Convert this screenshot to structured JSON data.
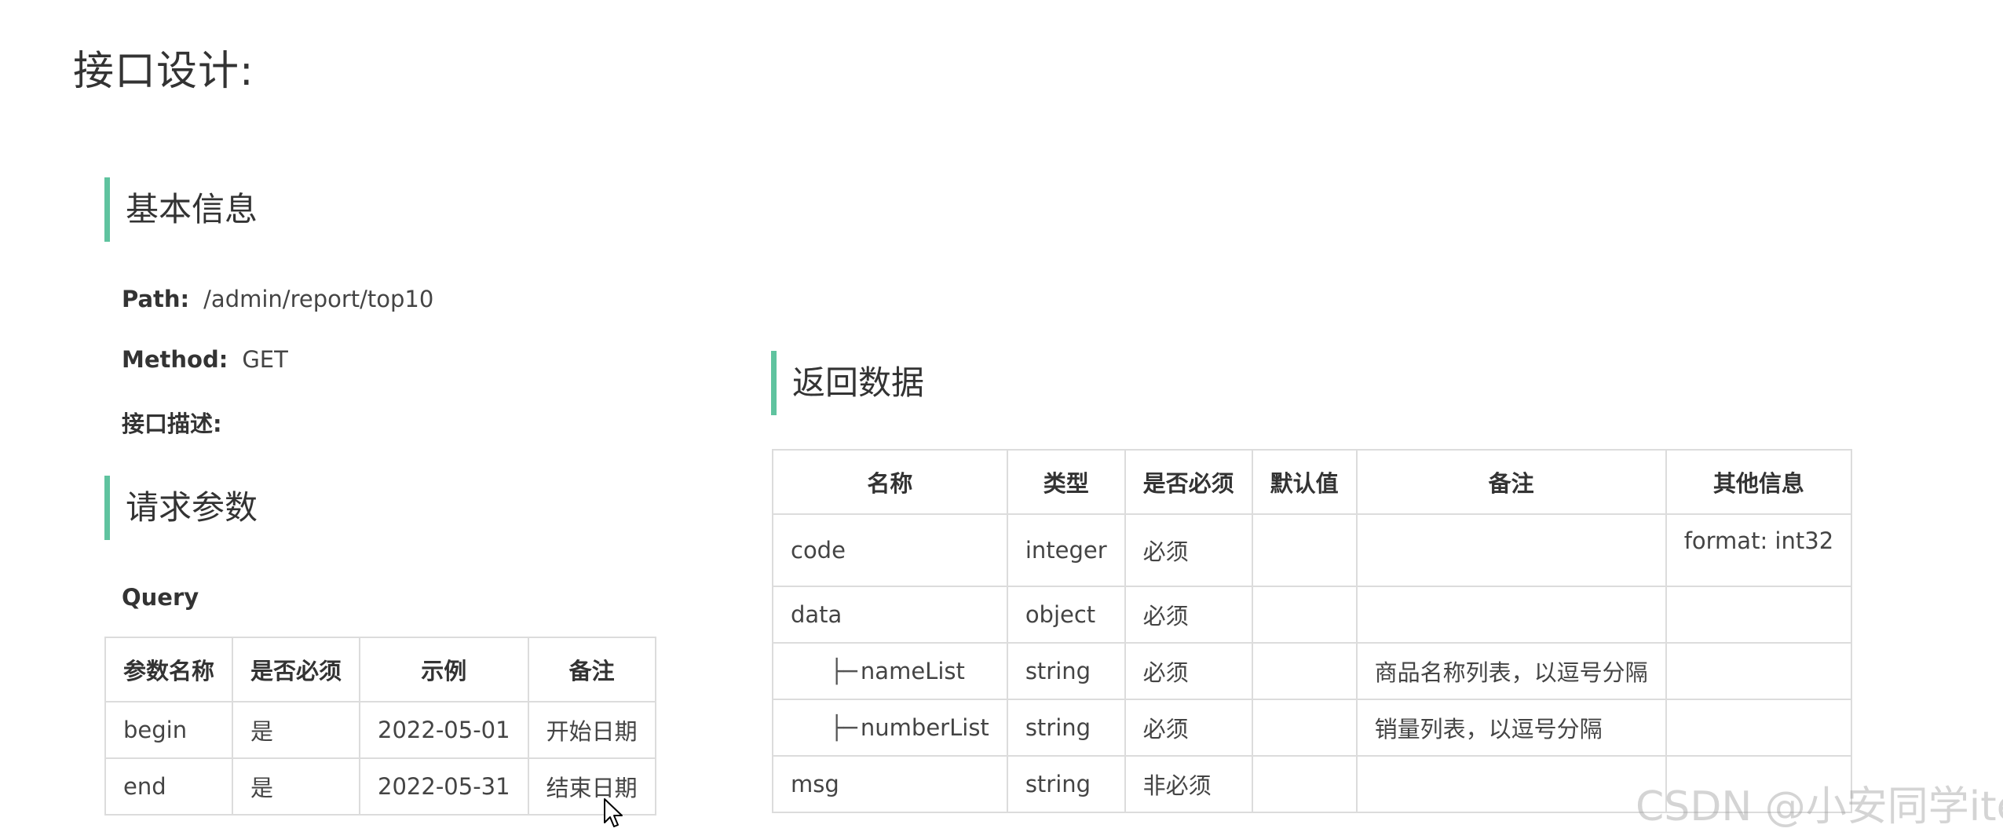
{
  "page_title": "接口设计:",
  "basic_info": {
    "heading": "基本信息",
    "path_label": "Path:",
    "path_value": "/admin/report/top10",
    "method_label": "Method:",
    "method_value": "GET",
    "desc_label": "接口描述:"
  },
  "request": {
    "heading": "请求参数",
    "query_label": "Query",
    "headers": [
      "参数名称",
      "是否必须",
      "示例",
      "备注"
    ],
    "rows": [
      [
        "begin",
        "是",
        "2022-05-01",
        "开始日期"
      ],
      [
        "end",
        "是",
        "2022-05-31",
        "结束日期"
      ]
    ]
  },
  "response": {
    "heading": "返回数据",
    "headers": [
      "名称",
      "类型",
      "是否必须",
      "默认值",
      "备注",
      "其他信息"
    ],
    "tree_prefix": "├─",
    "rows": [
      [
        "code",
        "integer",
        "必须",
        "",
        "",
        "format: int32"
      ],
      [
        "data",
        "object",
        "必须",
        "",
        "",
        ""
      ],
      [
        "nameList",
        "string",
        "必须",
        "",
        "商品名称列表，以逗号分隔",
        ""
      ],
      [
        "numberList",
        "string",
        "必须",
        "",
        "销量列表，以逗号分隔",
        ""
      ],
      [
        "msg",
        "string",
        "非必须",
        "",
        "",
        ""
      ]
    ]
  },
  "watermark": "CSDN @小安同学iter"
}
